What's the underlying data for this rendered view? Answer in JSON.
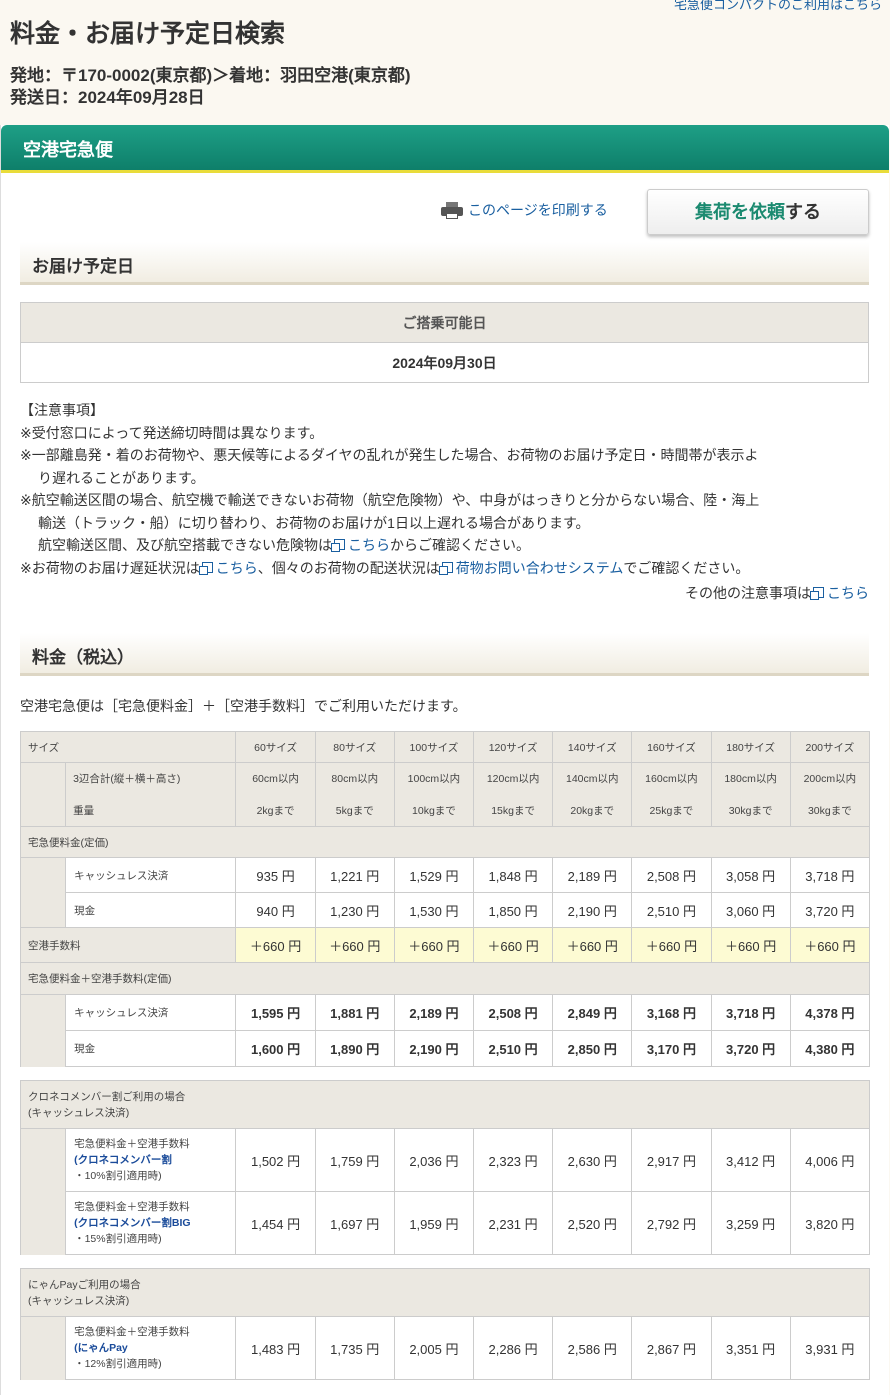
{
  "top_link": "宅急便コンパクトのご利用はこちら",
  "page_title": "料金・お届け予定日検索",
  "route": {
    "line1": "発地：〒170-0002(東京都)＞着地：羽田空港(東京都)",
    "line2": "発送日：2024年09月28日"
  },
  "service_name": "空港宅急便",
  "print_label": "このページを印刷する",
  "pickup_button": {
    "green": "集荷を依頼",
    "rest": "する"
  },
  "delivery_section_title": "お届け予定日",
  "boarding_header": "ご搭乗可能日",
  "boarding_date": "2024年09月30日",
  "notes": {
    "heading": "【注意事項】",
    "n1": "※受付窓口によって発送締切時間は異なります。",
    "n2a": "※一部離島発・着のお荷物や、悪天候等によるダイヤの乱れが発生した場合、お荷物のお届け予定日・時間帯が表示よ",
    "n2b": "り遅れることがあります。",
    "n3a": "※航空輸送区間の場合、航空機で輸送できないお荷物（航空危険物）や、中身がはっきりと分からない場合、陸・海上",
    "n3b": "輸送（トラック・船）に切り替わり、お荷物のお届けが1日以上遅れる場合があります。",
    "n3c_pre": "航空輸送区間、及び航空搭載できない危険物は",
    "n3c_link": "こちら",
    "n3c_post": "からご確認ください。",
    "n4_pre": "※お荷物のお届け遅延状況は",
    "n4_link1": "こちら",
    "n4_mid": "、個々のお荷物の配送状況は",
    "n4_link2": "荷物お問い合わせシステム",
    "n4_post": "でご確認ください。",
    "other_pre": "その他の注意事項は",
    "other_link": "こちら"
  },
  "fee_section_title": "料金（税込）",
  "fee_intro": "空港宅急便は［宅急便料金］＋［空港手数料］でご利用いただけます。",
  "fee_table": {
    "size_label": "サイズ",
    "sizes": [
      "60サイズ",
      "80サイズ",
      "100サイズ",
      "120サイズ",
      "140サイズ",
      "160サイズ",
      "180サイズ",
      "200サイズ"
    ],
    "dim_label": "3辺合計(縦＋横＋高さ)",
    "dims": [
      "60cm以内",
      "80cm以内",
      "100cm以内",
      "120cm以内",
      "140cm以内",
      "160cm以内",
      "180cm以内",
      "200cm以内"
    ],
    "weight_label": "重量",
    "weights": [
      "2kgまで",
      "5kgまで",
      "10kgまで",
      "15kgまで",
      "20kgまで",
      "25kgまで",
      "30kgまで",
      "30kgまで"
    ],
    "base_label": "宅急便料金(定価)",
    "cashless_label": "キャッシュレス決済",
    "cash_label": "現金",
    "base_cashless": [
      "935 円",
      "1,221 円",
      "1,529 円",
      "1,848 円",
      "2,189 円",
      "2,508 円",
      "3,058 円",
      "3,718 円"
    ],
    "base_cash": [
      "940 円",
      "1,230 円",
      "1,530 円",
      "1,850 円",
      "2,190 円",
      "2,510 円",
      "3,060 円",
      "3,720 円"
    ],
    "airport_fee_label": "空港手数料",
    "airport_fee": [
      "＋660 円",
      "＋660 円",
      "＋660 円",
      "＋660 円",
      "＋660 円",
      "＋660 円",
      "＋660 円",
      "＋660 円"
    ],
    "total_label": "宅急便料金＋空港手数料(定価)",
    "total_cashless": [
      "1,595 円",
      "1,881 円",
      "2,189 円",
      "2,508 円",
      "2,849 円",
      "3,168 円",
      "3,718 円",
      "4,378 円"
    ],
    "total_cash": [
      "1,600 円",
      "1,890 円",
      "2,190 円",
      "2,510 円",
      "2,850 円",
      "3,170 円",
      "3,720 円",
      "4,380 円"
    ]
  },
  "member_table": {
    "heading1": "クロネコメンバー割ご利用の場合",
    "heading2": "(キャッシュレス決済)",
    "row1": {
      "l1": "宅急便料金＋空港手数料",
      "l2": "(クロネコメンバー割",
      "l3": "・10%割引適用時)",
      "values": [
        "1,502 円",
        "1,759 円",
        "2,036 円",
        "2,323 円",
        "2,630 円",
        "2,917 円",
        "3,412 円",
        "4,006 円"
      ]
    },
    "row2": {
      "l1": "宅急便料金＋空港手数料",
      "l2": "(クロネコメンバー割BIG",
      "l3": "・15%割引適用時)",
      "values": [
        "1,454 円",
        "1,697 円",
        "1,959 円",
        "2,231 円",
        "2,520 円",
        "2,792 円",
        "3,259 円",
        "3,820 円"
      ]
    }
  },
  "nyan_table": {
    "heading1": "にゃんPayご利用の場合",
    "heading2": "(キャッシュレス決済)",
    "row1": {
      "l1": "宅急便料金＋空港手数料",
      "l2": "(にゃんPay",
      "l3": "・12%割引適用時)",
      "values": [
        "1,483 円",
        "1,735 円",
        "2,005 円",
        "2,286 円",
        "2,586 円",
        "2,867 円",
        "3,351 円",
        "3,931 円"
      ]
    }
  }
}
